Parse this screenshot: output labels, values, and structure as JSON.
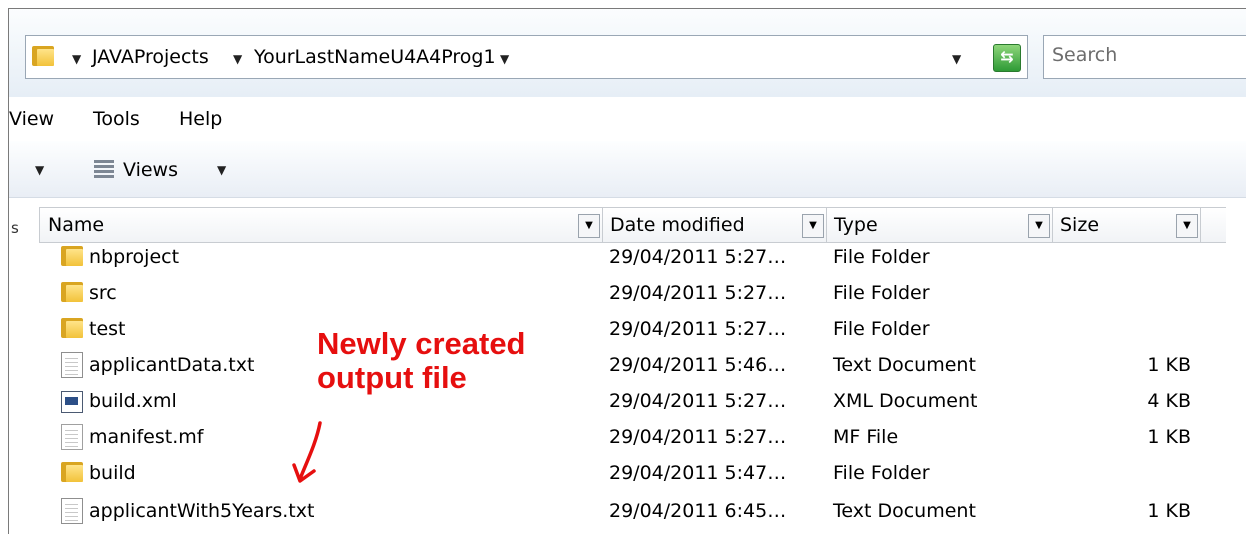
{
  "address_bar": {
    "crumbs": [
      "JAVAProjects",
      "YourLastNameU4A4Prog1"
    ]
  },
  "search": {
    "placeholder": "Search"
  },
  "menu": {
    "items": [
      "View",
      "Tools",
      "Help"
    ]
  },
  "toolbar": {
    "views_label": "Views"
  },
  "columns": [
    "Name",
    "Date modified",
    "Type",
    "Size"
  ],
  "side_letter": "s",
  "files": [
    {
      "name": "nbproject",
      "date": "29/04/2011 5:27…",
      "type": "File Folder",
      "size": "",
      "icon": "folder-icon"
    },
    {
      "name": "src",
      "date": "29/04/2011 5:27…",
      "type": "File Folder",
      "size": "",
      "icon": "folder-icon"
    },
    {
      "name": "test",
      "date": "29/04/2011 5:27…",
      "type": "File Folder",
      "size": "",
      "icon": "folder-icon"
    },
    {
      "name": "applicantData.txt",
      "date": "29/04/2011 5:46…",
      "type": "Text Document",
      "size": "1 KB",
      "icon": "text-file-icon"
    },
    {
      "name": "build.xml",
      "date": "29/04/2011 5:27…",
      "type": "XML Document",
      "size": "4 KB",
      "icon": "xml-file-icon"
    },
    {
      "name": "manifest.mf",
      "date": "29/04/2011 5:27…",
      "type": "MF File",
      "size": "1 KB",
      "icon": "blank-file-icon"
    },
    {
      "name": "build",
      "date": "29/04/2011 5:47…",
      "type": "File Folder",
      "size": "",
      "icon": "folder-icon"
    },
    {
      "name": "applicantWith5Years.txt",
      "date": "29/04/2011 6:45…",
      "type": "Text Document",
      "size": "1 KB",
      "icon": "text-file-icon"
    }
  ],
  "annotation": {
    "line1": "Newly created",
    "line2": "output file",
    "color": "#e60f0f"
  }
}
